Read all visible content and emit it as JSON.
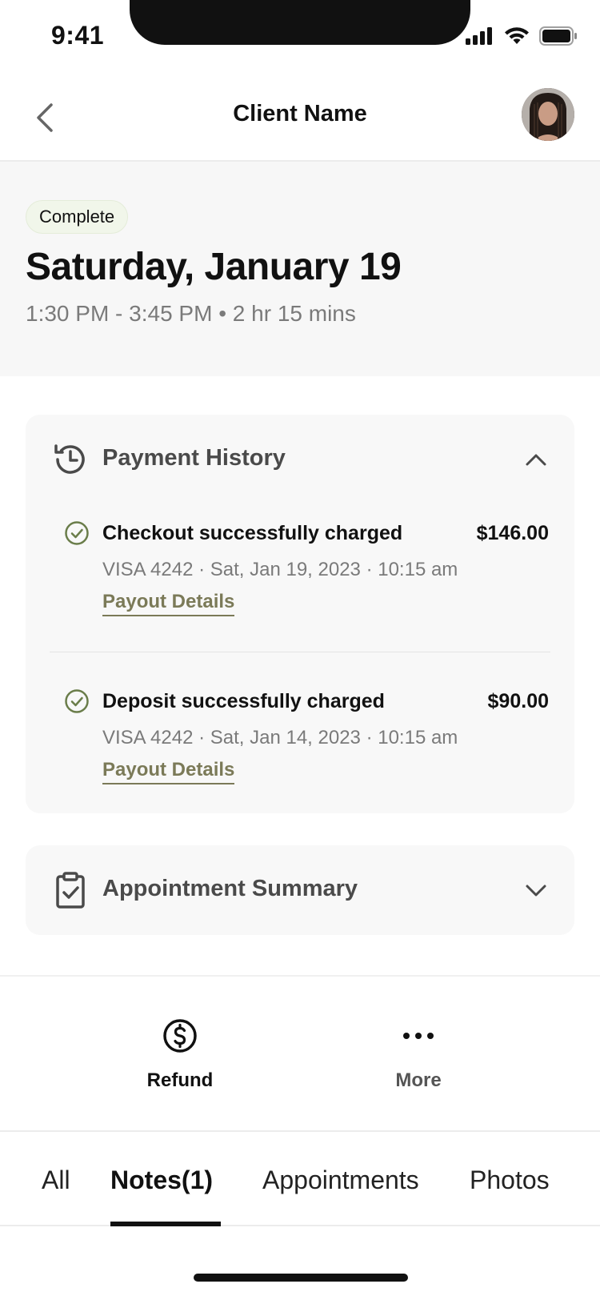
{
  "status_bar": {
    "time": "9:41"
  },
  "header": {
    "title": "Client Name"
  },
  "appointment": {
    "status": "Complete",
    "date": "Saturday, January 19",
    "time_range": "1:30 PM - 3:45 PM • 2 hr 15 mins"
  },
  "payment_history": {
    "title": "Payment History",
    "payments": [
      {
        "title": "Checkout successfully charged",
        "amount": "$146.00",
        "meta": "VISA 4242 · Sat, Jan 19, 2023 · 10:15 am",
        "link": "Payout Details"
      },
      {
        "title": "Deposit successfully charged",
        "amount": "$90.00",
        "meta": "VISA 4242 · Sat, Jan 14, 2023 · 10:15 am",
        "link": "Payout Details"
      }
    ]
  },
  "appointment_summary": {
    "title": "Appointment Summary"
  },
  "actions": {
    "refund": "Refund",
    "more": "More"
  },
  "tabs": {
    "all": "All",
    "notes": "Notes(1)",
    "appointments": "Appointments",
    "photos": "Photos"
  },
  "colors": {
    "accent_olive": "#7b7a58",
    "success_green": "#6a7d4a",
    "badge_bg": "#f1f6ea",
    "muted_text": "#7a7a7a",
    "card_bg": "#f8f8f8"
  },
  "icons": {
    "back": "chevron-left-icon",
    "payment_history": "history-icon",
    "collapse": "chevron-up-icon",
    "check": "check-circle-icon",
    "summary": "clipboard-check-icon",
    "expand": "chevron-down-icon",
    "refund": "dollar-circle-icon",
    "more": "ellipsis-icon"
  }
}
